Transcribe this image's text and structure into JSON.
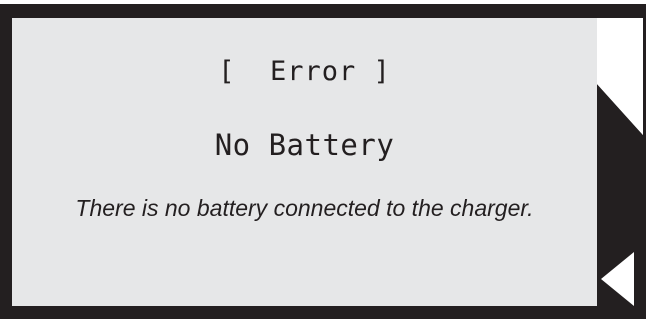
{
  "screen": {
    "title": "[  Error ]",
    "heading": "No Battery",
    "message": "There is no battery connected to the charger."
  },
  "icons": {
    "back": "back-arrow-icon"
  },
  "colors": {
    "bezel": "#231f20",
    "lcd_background": "#e6e7e8",
    "text": "#231f20",
    "arrow": "#ffffff"
  }
}
